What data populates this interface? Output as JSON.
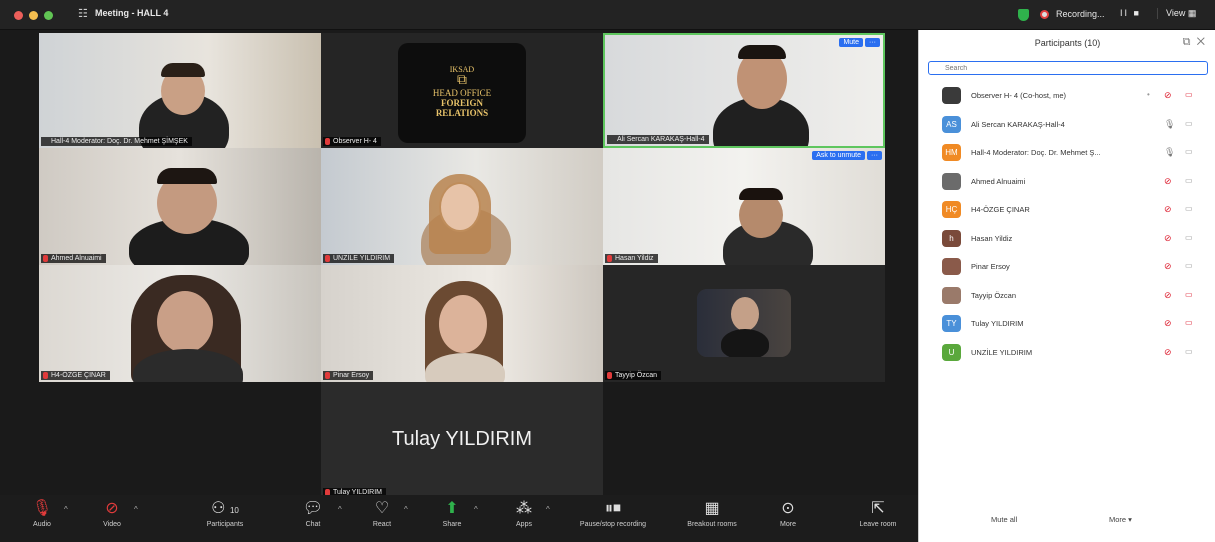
{
  "window": {
    "title": "Meeting - HALL 4",
    "recording_label": "Recording...",
    "recording_controls": "II ■",
    "view_label": "View"
  },
  "tiles": [
    {
      "name": "Hall-4 Moderator: Doç. Dr. Mehmet ŞİMŞEK",
      "muted": false
    },
    {
      "name": "Observer H- 4",
      "muted": true,
      "logo": {
        "line1": "IKSAD",
        "line2": "HEAD OFFICE",
        "line3": "FOREIGN",
        "line4": "RELATIONS"
      }
    },
    {
      "name": "Ali Sercan KARAKAŞ-Hall-4",
      "muted": false,
      "badges": [
        "Mute",
        "···"
      ]
    },
    {
      "name": "Ahmed Alnuaimi",
      "muted": true
    },
    {
      "name": "UNZİLE YILDIRIM",
      "muted": true
    },
    {
      "name": "Hasan Yildiz",
      "muted": true,
      "badges": [
        "Ask to unmute",
        "···"
      ]
    },
    {
      "name": "H4-ÖZGE ÇINAR",
      "muted": true
    },
    {
      "name": "Pinar Ersoy",
      "muted": true
    },
    {
      "name": "Tayyip Özcan",
      "muted": true
    },
    {
      "name": "Tulay YILDIRIM",
      "muted": true,
      "big_name": "Tulay YILDIRIM"
    }
  ],
  "toolbar": {
    "audio": "Audio",
    "video": "Video",
    "participants": "Participants",
    "participants_count": "10",
    "chat": "Chat",
    "react": "React",
    "share": "Share",
    "apps": "Apps",
    "pause_stop": "Pause/stop recording",
    "breakout": "Breakout rooms",
    "more": "More",
    "leave": "Leave room"
  },
  "panel": {
    "title": "Participants (10)",
    "search_placeholder": "Search",
    "participants": [
      {
        "name": "Observer H- 4 (Co-host, me)",
        "avatar": "",
        "color": "#3a3a3a",
        "mic": "muted",
        "cam": "off"
      },
      {
        "name": "Ali Sercan KARAKAŞ-Hall-4",
        "avatar": "AS",
        "color": "#4a90d9",
        "mic": "on",
        "cam": "on"
      },
      {
        "name": "Hall-4 Moderator: Doç. Dr. Mehmet Ş...",
        "avatar": "HM",
        "color": "#f08a24",
        "mic": "on",
        "cam": "on"
      },
      {
        "name": "Ahmed Alnuaimi",
        "avatar": "",
        "color": "#6b6b6b",
        "mic": "muted",
        "cam": "on"
      },
      {
        "name": "H4-ÖZGE ÇINAR",
        "avatar": "HÇ",
        "color": "#f08a24",
        "mic": "muted",
        "cam": "on"
      },
      {
        "name": "Hasan Yildiz",
        "avatar": "h",
        "color": "#7a4a3a",
        "mic": "muted",
        "cam": "on"
      },
      {
        "name": "Pinar Ersoy",
        "avatar": "",
        "color": "#8a5a4a",
        "mic": "muted",
        "cam": "on"
      },
      {
        "name": "Tayyip Özcan",
        "avatar": "",
        "color": "#9a7a6a",
        "mic": "muted",
        "cam": "off"
      },
      {
        "name": "Tulay YILDIRIM",
        "avatar": "TY",
        "color": "#4a90d9",
        "mic": "muted",
        "cam": "off"
      },
      {
        "name": "UNZİLE YILDIRIM",
        "avatar": "U",
        "color": "#5aa83c",
        "mic": "muted",
        "cam": "on"
      }
    ],
    "mute_all": "Mute all",
    "more": "More ▾"
  }
}
